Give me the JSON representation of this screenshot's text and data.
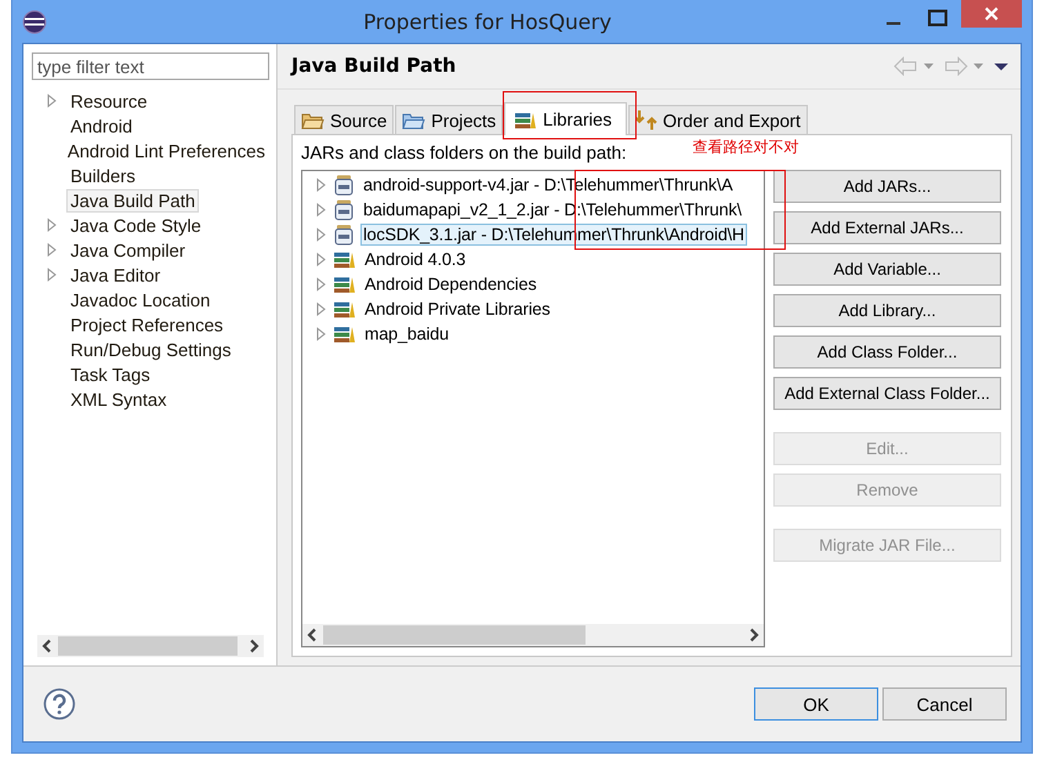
{
  "window": {
    "title": "Properties for HosQuery"
  },
  "filter": {
    "placeholder": "type filter text"
  },
  "nav": [
    {
      "label": "Resource",
      "expandable": true,
      "selected": false
    },
    {
      "label": "Android",
      "expandable": false,
      "selected": false
    },
    {
      "label": "Android Lint Preferences",
      "expandable": false,
      "selected": false
    },
    {
      "label": "Builders",
      "expandable": false,
      "selected": false
    },
    {
      "label": "Java Build Path",
      "expandable": false,
      "selected": true
    },
    {
      "label": "Java Code Style",
      "expandable": true,
      "selected": false
    },
    {
      "label": "Java Compiler",
      "expandable": true,
      "selected": false
    },
    {
      "label": "Java Editor",
      "expandable": true,
      "selected": false
    },
    {
      "label": "Javadoc Location",
      "expandable": false,
      "selected": false
    },
    {
      "label": "Project References",
      "expandable": false,
      "selected": false
    },
    {
      "label": "Run/Debug Settings",
      "expandable": false,
      "selected": false
    },
    {
      "label": "Task Tags",
      "expandable": false,
      "selected": false
    },
    {
      "label": "XML Syntax",
      "expandable": false,
      "selected": false
    }
  ],
  "page": {
    "title": "Java Build Path"
  },
  "tabs": [
    {
      "label": "Source",
      "kind": "source",
      "selected": false
    },
    {
      "label": "Projects",
      "kind": "projects",
      "selected": false
    },
    {
      "label": "Libraries",
      "kind": "libraries",
      "selected": true
    },
    {
      "label": "Order and Export",
      "kind": "order",
      "selected": false
    }
  ],
  "list_label": "JARs and class folders on the build path:",
  "annotation": "查看路径对不对",
  "entries": [
    {
      "kind": "jar",
      "text": "android-support-v4.jar - D:\\Telehummer\\Thrunk\\A",
      "selected": false
    },
    {
      "kind": "jar",
      "text": "baidumapapi_v2_1_2.jar - D:\\Telehummer\\Thrunk\\",
      "selected": false
    },
    {
      "kind": "jar",
      "text": "locSDK_3.1.jar - D:\\Telehummer\\Thrunk\\Android\\H",
      "selected": true
    },
    {
      "kind": "library",
      "text": "Android 4.0.3",
      "selected": false
    },
    {
      "kind": "library",
      "text": "Android Dependencies",
      "selected": false
    },
    {
      "kind": "library",
      "text": "Android Private Libraries",
      "selected": false
    },
    {
      "kind": "library",
      "text": "map_baidu",
      "selected": false
    }
  ],
  "buttons": [
    {
      "label": "Add JARs...",
      "disabled": false
    },
    {
      "label": "Add External JARs...",
      "disabled": false
    },
    {
      "label": "Add Variable...",
      "disabled": false
    },
    {
      "label": "Add Library...",
      "disabled": false
    },
    {
      "label": "Add Class Folder...",
      "disabled": false
    },
    {
      "label": "Add External Class Folder...",
      "disabled": false
    },
    {
      "label": "Edit...",
      "disabled": true
    },
    {
      "label": "Remove",
      "disabled": true
    },
    {
      "label": "Migrate JAR File...",
      "disabled": true
    }
  ],
  "dialog_buttons": [
    {
      "label": "OK",
      "default": true
    },
    {
      "label": "Cancel",
      "default": false
    }
  ]
}
